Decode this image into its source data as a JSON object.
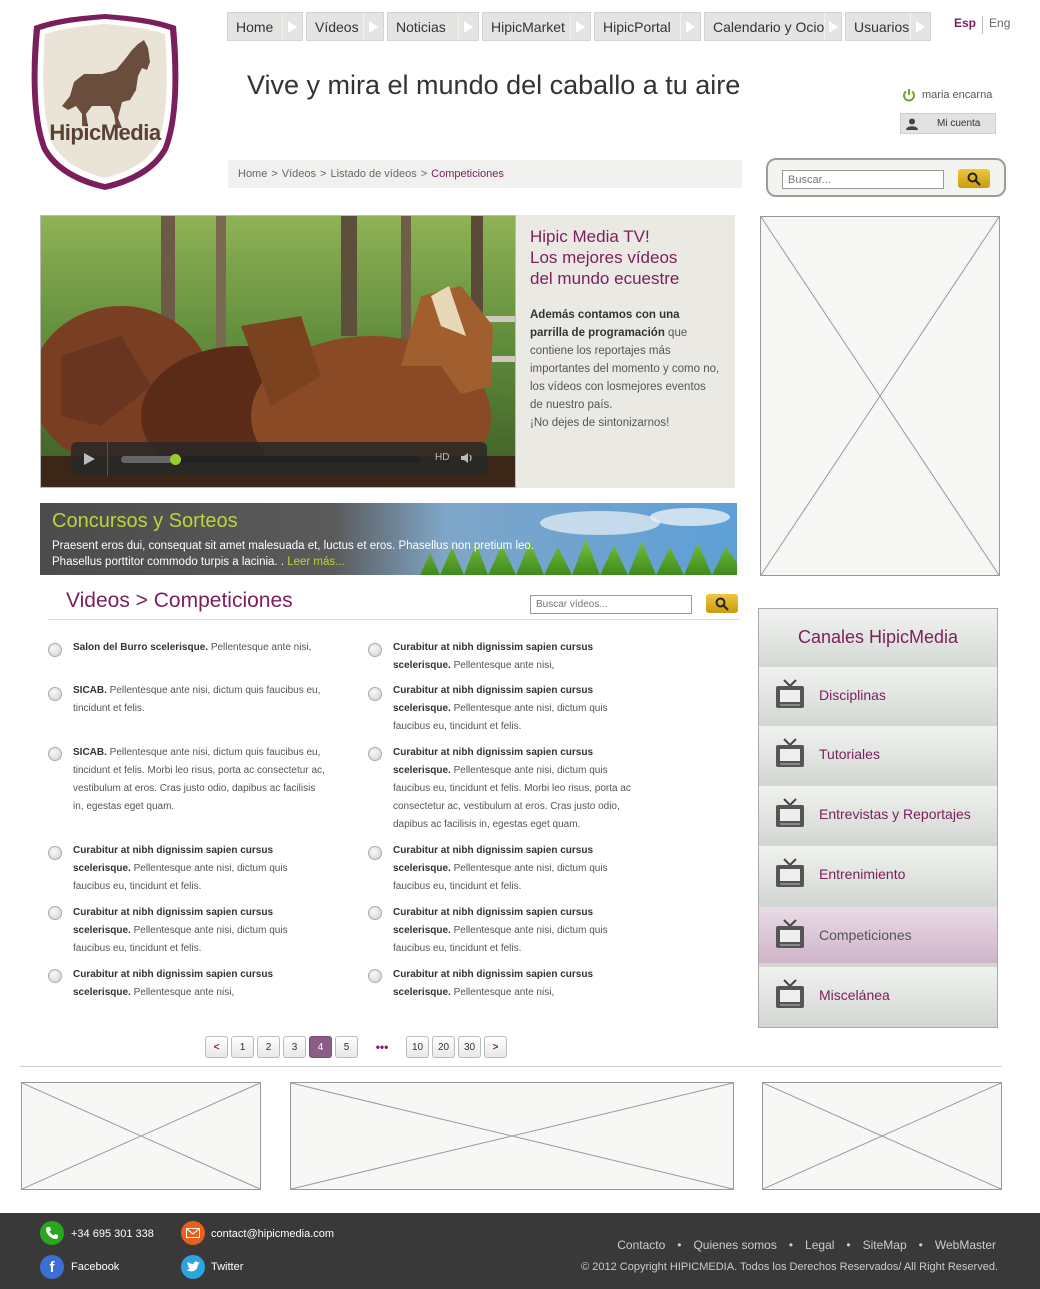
{
  "brand": {
    "name": "HipicMedia",
    "accent": "#7a1f5c"
  },
  "nav": {
    "items": [
      {
        "label": "Home"
      },
      {
        "label": "Vídeos"
      },
      {
        "label": "Noticias"
      },
      {
        "label": "HipicMarket"
      },
      {
        "label": "HipicPortal"
      },
      {
        "label": "Calendario y Ocio"
      },
      {
        "label": "Usuarios"
      }
    ]
  },
  "lang": {
    "esp": "Esp",
    "eng": "Eng"
  },
  "tagline": "Vive y mira el mundo del caballo a tu aire",
  "user": {
    "name": "maria encarna",
    "account_label": "Mi cuenta"
  },
  "breadcrumb": {
    "home": "Home",
    "sep": ">",
    "videos": "Vídeos",
    "list": "Listado de vídeos",
    "current": "Competiciones"
  },
  "search": {
    "placeholder": "Buscar..."
  },
  "video": {
    "hd": "HD",
    "progress": 0.18
  },
  "tv": {
    "title_1": "Hipic Media TV!",
    "title_2": "Los mejores vídeos",
    "title_3": "del mundo ecuestre",
    "bold": "Además contamos con una parrilla de programación",
    "text": " que contiene los reportajes más importantes del momento y como no, los vídeos con losmejores eventos de nuestro país.",
    "cta": "¡No dejes de sintonizarnos!"
  },
  "promo": {
    "title": "Concursos y Sorteos",
    "text": "Praesent eros dui, consequat sit amet malesuada et, luctus et eros. Phasellus non pretium leo. Phasellus porttitor commodo turpis a lacinia. . ",
    "more": "Leer más..."
  },
  "section": {
    "title": "Videos > Competiciones",
    "search_placeholder": "Buscar vídeos..."
  },
  "videos_left": [
    {
      "bold": "Salon del Burro scelerisque.",
      "text": " Pellentesque ante nisi,"
    },
    {
      "bold": "SICAB.",
      "text": " Pellentesque ante nisi, dictum quis faucibus eu, tincidunt et felis."
    },
    {
      "bold": "SICAB.",
      "text": " Pellentesque ante nisi, dictum quis faucibus eu, tincidunt et felis. Morbi leo risus, porta ac consectetur ac, vestibulum at eros. Cras justo odio, dapibus ac facilisis in, egestas eget quam."
    },
    {
      "bold": "Curabitur at nibh dignissim sapien cursus scelerisque.",
      "text": " Pellentesque ante nisi, dictum quis faucibus eu, tincidunt et felis."
    },
    {
      "bold": "Curabitur at nibh dignissim sapien cursus scelerisque.",
      "text": " Pellentesque ante nisi, dictum quis faucibus eu, tincidunt et felis."
    },
    {
      "bold": "Curabitur at nibh dignissim sapien cursus scelerisque.",
      "text": " Pellentesque ante nisi,"
    }
  ],
  "videos_right": [
    {
      "bold": "Curabitur at nibh dignissim sapien cursus scelerisque.",
      "text": " Pellentesque ante nisi,"
    },
    {
      "bold": "Curabitur at nibh dignissim sapien cursus scelerisque.",
      "text": " Pellentesque ante nisi, dictum quis faucibus eu, tincidunt et felis."
    },
    {
      "bold": "Curabitur at nibh dignissim sapien cursus scelerisque.",
      "text": " Pellentesque ante nisi, dictum quis faucibus eu, tincidunt et felis. Morbi leo risus, porta ac consectetur ac, vestibulum at eros. Cras justo odio, dapibus ac facilisis in, egestas eget quam."
    },
    {
      "bold": "Curabitur at nibh dignissim sapien cursus scelerisque.",
      "text": " Pellentesque ante nisi, dictum quis faucibus eu, tincidunt et felis."
    },
    {
      "bold": "Curabitur at nibh dignissim sapien cursus scelerisque.",
      "text": " Pellentesque ante nisi, dictum quis faucibus eu, tincidunt et felis."
    },
    {
      "bold": "Curabitur at nibh dignissim sapien cursus scelerisque.",
      "text": " Pellentesque ante nisi,"
    }
  ],
  "pager": {
    "prev": "<",
    "next": ">",
    "dots": "•••",
    "pages_a": [
      "1",
      "2",
      "3",
      "4",
      "5"
    ],
    "pages_b": [
      "10",
      "20",
      "30"
    ],
    "active": "4"
  },
  "channels": {
    "title": "Canales HipicMedia",
    "items": [
      {
        "label": "Disciplinas"
      },
      {
        "label": "Tutoriales"
      },
      {
        "label": "Entrevistas y Reportajes"
      },
      {
        "label": "Entrenimiento"
      },
      {
        "label": "Competiciones"
      },
      {
        "label": "Miscelánea"
      }
    ],
    "active": "Competiciones"
  },
  "footer": {
    "phone": "+34 695 301 338",
    "email": "contact@hipicmedia.com",
    "facebook": "Facebook",
    "twitter": "Twitter",
    "links": [
      "Contacto",
      "Quienes somos",
      "Legal",
      "SiteMap",
      "WebMaster"
    ],
    "link_sep": "•",
    "copyright": "© 2012 Copyright HIPICMEDIA. Todos los Derechos Reservados/ All Right Reserved."
  }
}
